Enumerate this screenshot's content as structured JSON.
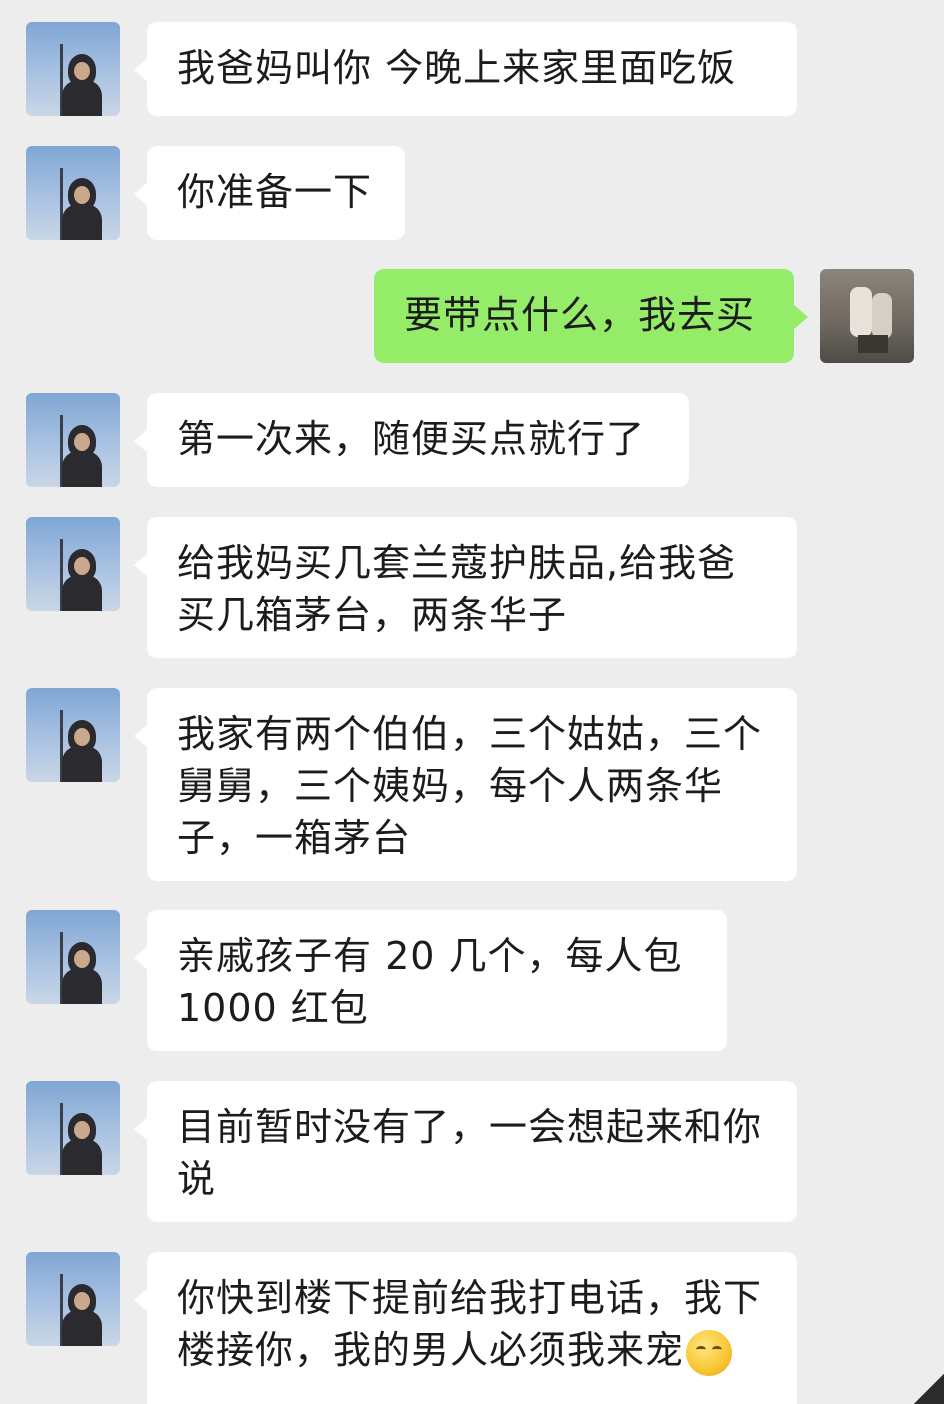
{
  "messages": [
    {
      "sender": "other",
      "text": "我爸妈叫你 今晚上来家里面吃饭"
    },
    {
      "sender": "other",
      "text": "你准备一下"
    },
    {
      "sender": "me",
      "text": "要带点什么，我去买"
    },
    {
      "sender": "other",
      "text": "第一次来，随便买点就行了"
    },
    {
      "sender": "other",
      "line1": "给我妈买几套兰蔻护肤品,给我爸",
      "line2": "买几箱茅台，两条华子"
    },
    {
      "sender": "other",
      "line1": "我家有两个伯伯，三个姑姑，三个",
      "line2": "舅舅，三个姨妈，每个人两条华",
      "line3": "子，一箱茅台"
    },
    {
      "sender": "other",
      "line1": "亲戚孩子有 20 几个，每人包",
      "line2": "1000 红包"
    },
    {
      "sender": "other",
      "line1": "目前暂时没有了，一会想起来和你",
      "line2": "说"
    },
    {
      "sender": "other",
      "line1": "你快到楼下提前给我打电话，我下",
      "line2": "楼接你，我的男人必须我来宠"
    }
  ],
  "emoji_icon": "blush-face-emoji",
  "colors": {
    "background": "#ededed",
    "bubble_other": "#ffffff",
    "bubble_me": "#95ec69"
  }
}
